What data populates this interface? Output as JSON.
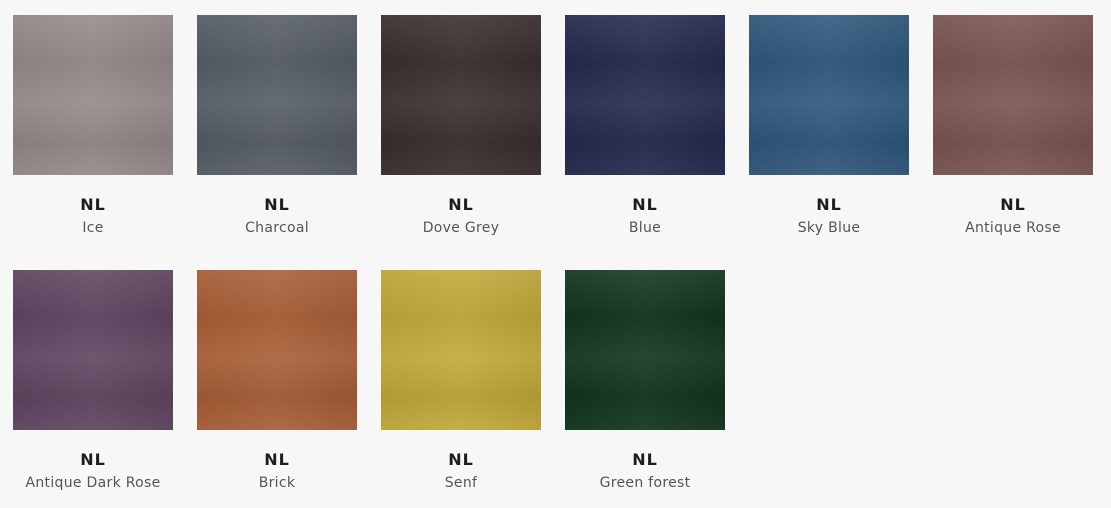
{
  "swatches": [
    {
      "code": "NL",
      "name": "Ice",
      "color": "#958a89"
    },
    {
      "code": "NL",
      "name": "Charcoal",
      "color": "#575d66"
    },
    {
      "code": "NL",
      "name": "Dove Grey",
      "color": "#3b2f2f"
    },
    {
      "code": "NL",
      "name": "Blue",
      "color": "#252a4e"
    },
    {
      "code": "NL",
      "name": "Sky Blue",
      "color": "#2f577b"
    },
    {
      "code": "NL",
      "name": "Antique Rose",
      "color": "#7a5553"
    },
    {
      "code": "NL",
      "name": "Antique Dark Rose",
      "color": "#5f4762"
    },
    {
      "code": "NL",
      "name": "Brick",
      "color": "#a85f37"
    },
    {
      "code": "NL",
      "name": "Senf",
      "color": "#c2a93a"
    },
    {
      "code": "NL",
      "name": "Green forest",
      "color": "#123521"
    }
  ]
}
